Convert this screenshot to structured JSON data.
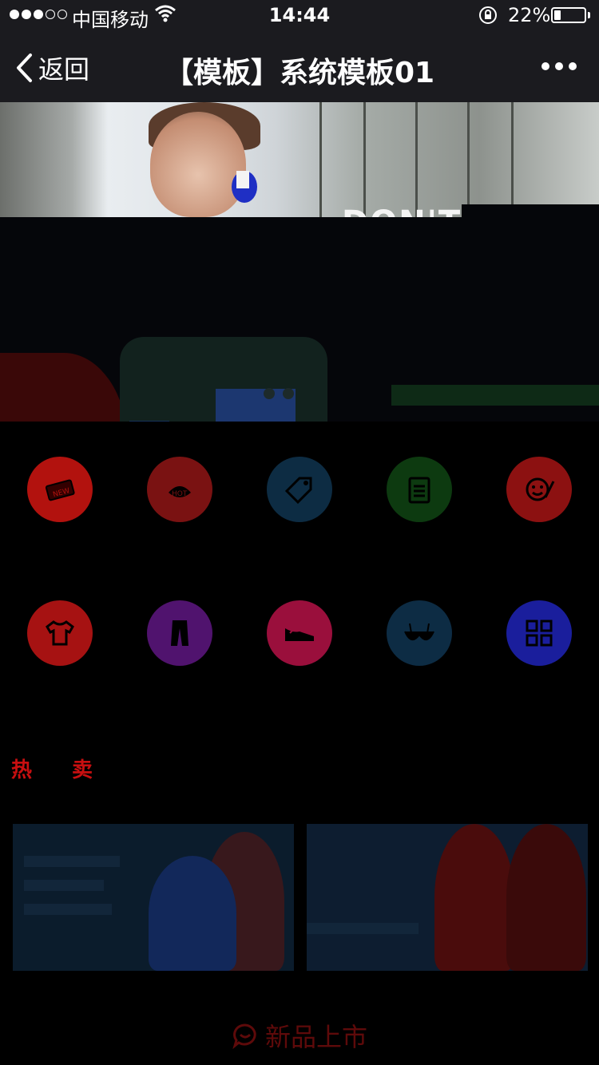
{
  "status_bar": {
    "carrier": "中国移动",
    "time": "14:44",
    "battery_percent": "22%",
    "battery_level": 0.22,
    "signal_bars_filled": 3,
    "signal_bars_total": 5
  },
  "nav_bar": {
    "back_label": "返回",
    "title": "【模板】系统模板01"
  },
  "banner": {
    "headline": "DON'T"
  },
  "categories": [
    {
      "icon": "new-tag-icon",
      "color": "#b2120e"
    },
    {
      "icon": "hot-tag-icon",
      "color": "#7a1212"
    },
    {
      "icon": "discount-tag-icon",
      "color": "#0d2c43"
    },
    {
      "icon": "clipboard-icon",
      "color": "#0d3a10"
    },
    {
      "icon": "smile-icon",
      "color": "#8c1111"
    },
    {
      "icon": "tshirt-icon",
      "color": "#a61212"
    },
    {
      "icon": "pants-icon",
      "color": "#50136e"
    },
    {
      "icon": "shoe-icon",
      "color": "#9a0f3c"
    },
    {
      "icon": "bra-icon",
      "color": "#0d2c44"
    },
    {
      "icon": "grid-icon",
      "color": "#1a1e9c"
    }
  ],
  "hot_section": {
    "title": "热卖"
  },
  "footer": {
    "label": "新品上市"
  }
}
